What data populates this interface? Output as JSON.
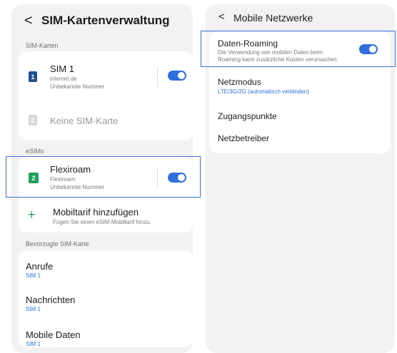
{
  "left": {
    "header": {
      "back_glyph": "<",
      "title": "SIM-Kartenverwaltung"
    },
    "sim_cards_section": "SIM-Karten",
    "sim1": {
      "icon_label": "1",
      "title": "SIM 1",
      "line1": "internet.de",
      "line2": "Unbekannte Nummer",
      "toggle": "on"
    },
    "sim2": {
      "icon_label": "2",
      "title": "Keine SIM-Karte"
    },
    "esims_section": "eSIMs",
    "esim": {
      "title": "Flexiroam",
      "line1": "Flexiroam",
      "line2": "Unbekannte Nummer",
      "toggle": "on"
    },
    "add_plan": {
      "icon": "+",
      "title": "Mobiltarif hinzufügen",
      "sub": "Fügen Sie einen eSIM-Mobiltarif hinzu."
    },
    "preferred_section": "Bevorzugte SIM-Karte",
    "preferred": [
      {
        "title": "Anrufe",
        "value": "SIM 1"
      },
      {
        "title": "Nachrichten",
        "value": "SIM 1"
      },
      {
        "title": "Mobile Daten",
        "value": "SIM 1"
      }
    ]
  },
  "right": {
    "header": {
      "back_glyph": "<",
      "title": "Mobile Netzwerke"
    },
    "roaming": {
      "title": "Daten-Roaming",
      "line1": "Die Verwendung von mobilen Daten beim",
      "line2": "Roaming kann zusätzliche Kosten verursachen.",
      "toggle": "on"
    },
    "netzmodus": {
      "title": "Netzmodus",
      "value": "LTE/3G/2G (automatisch verbinden)"
    },
    "zugangspunkte": "Zugangspunkte",
    "netzbetreiber": "Netzbetreiber"
  },
  "colors": {
    "accent": "#2f6fdc",
    "highlight": "#3b6fd6",
    "panel_bg": "#f2f2f4",
    "esim_green": "#1fa05a"
  },
  "icons": [
    "back-chevron-icon",
    "sim-1-icon",
    "sim-2-icon",
    "esim-chip-icon",
    "plus-icon"
  ]
}
